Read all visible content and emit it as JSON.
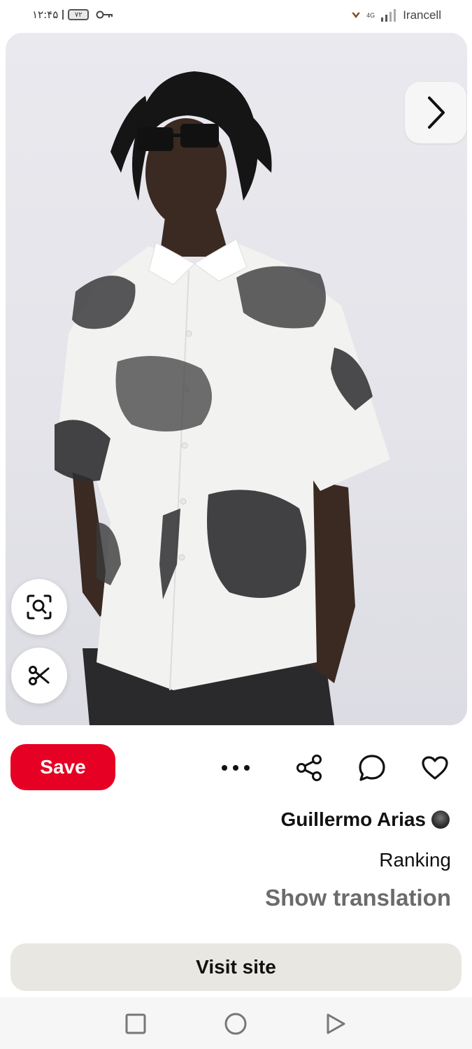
{
  "status_bar": {
    "time": "۱۲:۴۵",
    "battery": "۷۲",
    "network_type": "4G",
    "carrier": "Irancell"
  },
  "image": {
    "description_icons": {
      "next": "chevron-right-icon",
      "visual_search": "lens-search-icon",
      "cutout": "scissors-icon"
    }
  },
  "actions": {
    "save_label": "Save",
    "more": "more-icon",
    "share": "share-icon",
    "comment": "comment-icon",
    "like": "heart-icon"
  },
  "pin_meta": {
    "creator_name": "Guillermo Arias",
    "board_name": "Ranking",
    "translate_label": "Show translation"
  },
  "visit_label": "Visit site",
  "colors": {
    "primary_red": "#e60023",
    "visit_bg": "#e9e7e1",
    "muted_text": "#6b6b6b"
  }
}
